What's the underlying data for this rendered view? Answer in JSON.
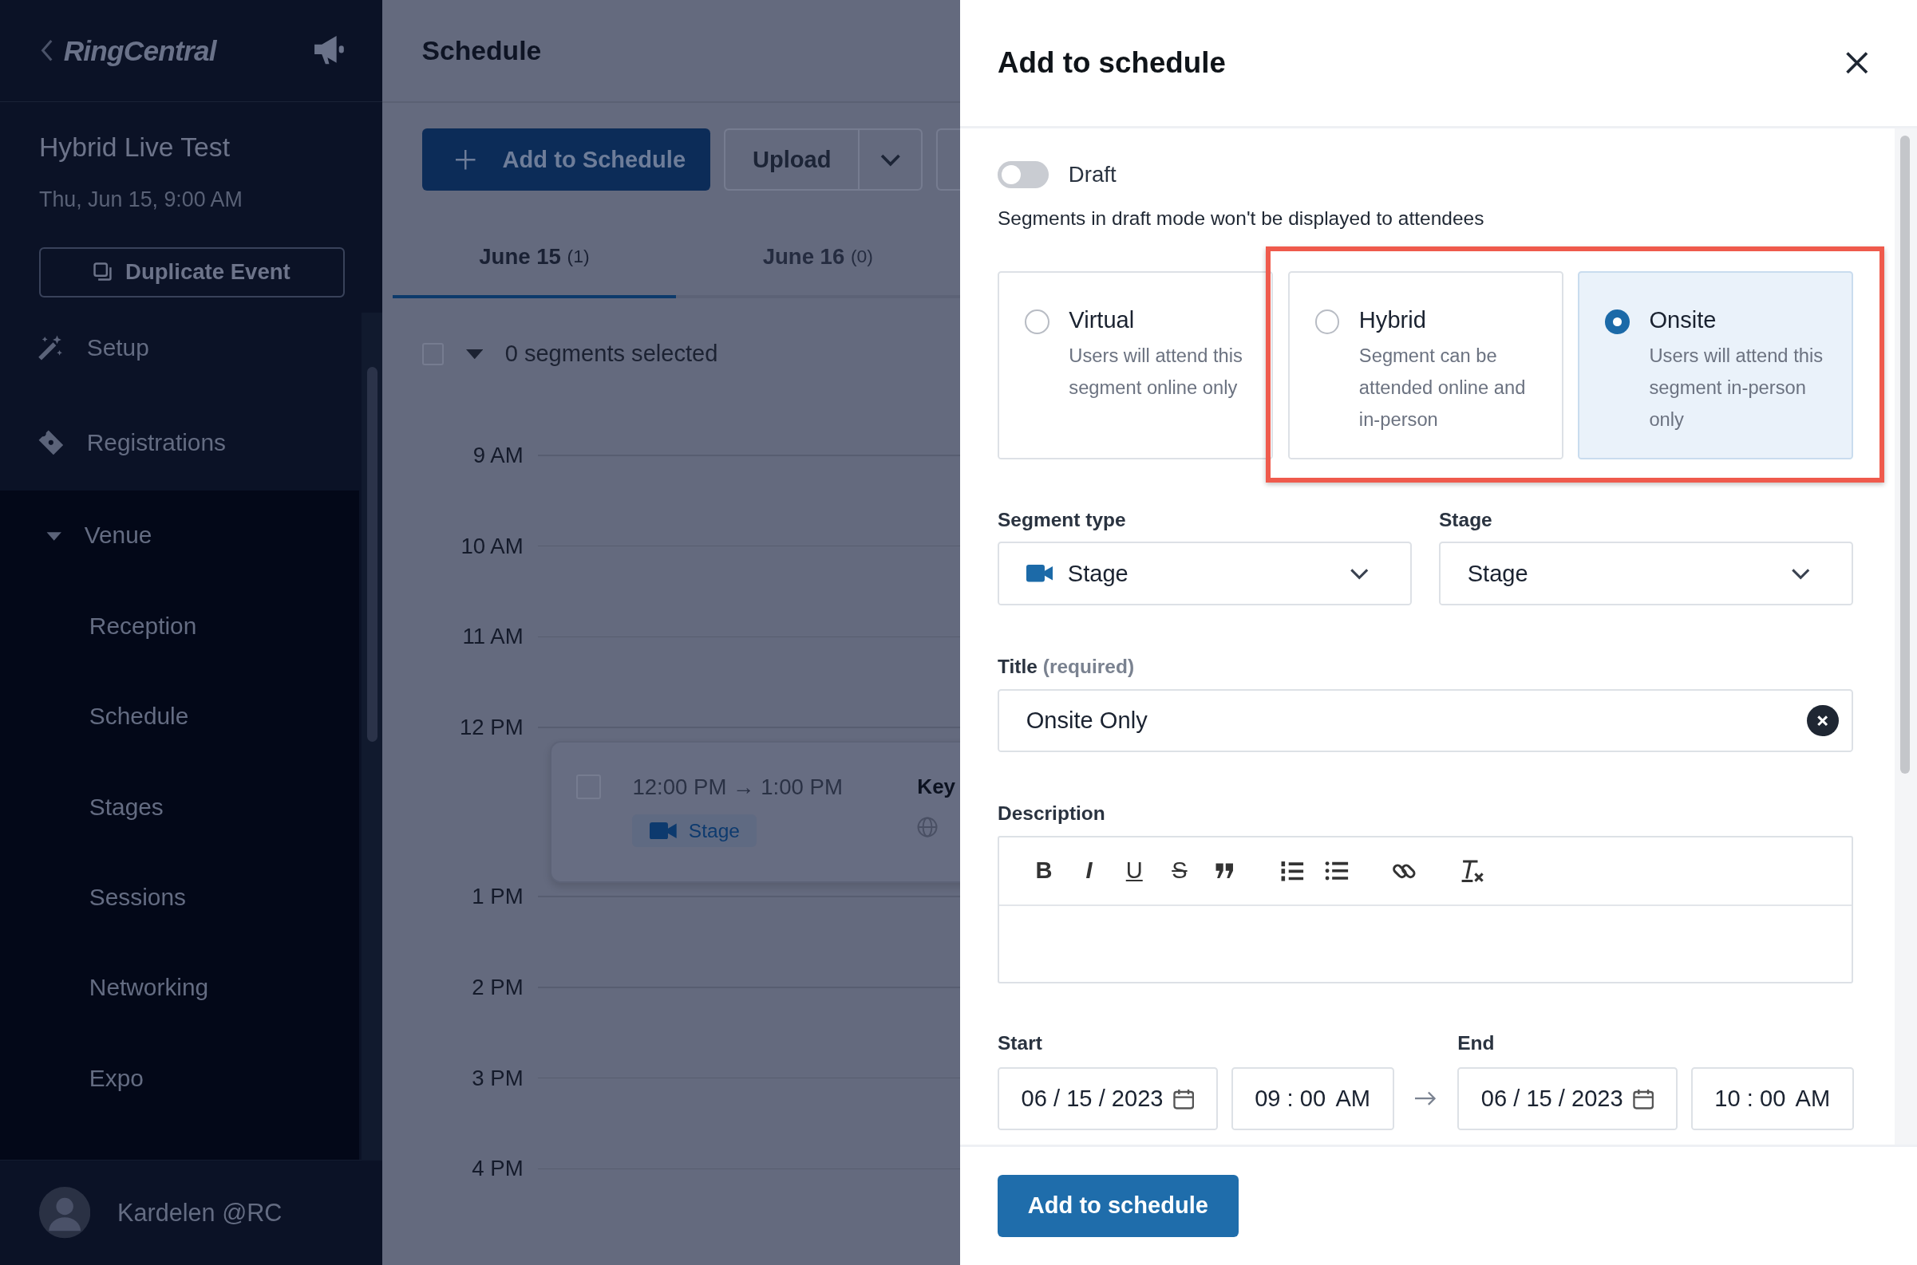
{
  "sidebar": {
    "logo": "RingCentral",
    "event_title": "Hybrid Live Test",
    "event_date": "Thu, Jun 15, 9:00 AM",
    "duplicate_button": "Duplicate Event",
    "nav_items": [
      {
        "label": "Setup",
        "kind": "wand"
      },
      {
        "label": "Registrations",
        "kind": "ticket"
      },
      {
        "label": "Venue",
        "kind": "group",
        "expanded": true,
        "children": [
          {
            "label": "Reception"
          },
          {
            "label": "Schedule"
          },
          {
            "label": "Stages"
          },
          {
            "label": "Sessions"
          },
          {
            "label": "Networking"
          },
          {
            "label": "Expo"
          }
        ]
      }
    ],
    "user": {
      "name": "Kardelen @RC"
    }
  },
  "main": {
    "title": "Schedule",
    "add_button": "Add to Schedule",
    "upload_button": "Upload",
    "tabs": [
      {
        "label": "June 15",
        "count": "(1)",
        "selected": true
      },
      {
        "label": "June 16",
        "count": "(0)",
        "selected": false
      }
    ],
    "select_all_checked": false,
    "selection_text": "0 segments selected",
    "hours": [
      {
        "label": "9 AM"
      },
      {
        "label": "10 AM"
      },
      {
        "label": "11 AM"
      },
      {
        "label": "12 PM",
        "events": [
          {
            "start": "12:00 PM",
            "arrow": "→",
            "end": "1:00 PM",
            "title": "Key",
            "tag": "Stage",
            "checked": false
          }
        ]
      },
      {
        "label": "1 PM"
      },
      {
        "label": "2 PM"
      },
      {
        "label": "3 PM"
      },
      {
        "label": "4 PM"
      }
    ]
  },
  "panel": {
    "title": "Add to schedule",
    "draft": {
      "label": "Draft",
      "on": false
    },
    "draft_hint": "Segments in draft mode won't be displayed to attendees",
    "attendance_options": [
      {
        "label": "Virtual",
        "description": "Users will attend this segment online only",
        "selected": false
      },
      {
        "label": "Hybrid",
        "description": "Segment can be attended online and in-person",
        "selected": false
      },
      {
        "label": "Onsite",
        "description": "Users will attend this segment in-person only",
        "selected": true
      }
    ],
    "segment_type": {
      "label": "Segment type",
      "value": "Stage"
    },
    "stage": {
      "label": "Stage",
      "value": "Stage"
    },
    "title_field": {
      "label": "Title",
      "note": "(required)",
      "value": "Onsite Only"
    },
    "description": {
      "label": "Description",
      "tools": [
        {
          "kind": "bold",
          "glyph": "B"
        },
        {
          "kind": "italic",
          "glyph": "I"
        },
        {
          "kind": "underline",
          "glyph": "U"
        },
        {
          "kind": "strike",
          "glyph": "S"
        },
        {
          "kind": "quote"
        },
        {
          "kind": "ordered-list"
        },
        {
          "kind": "bullet-list"
        },
        {
          "kind": "link"
        },
        {
          "kind": "clear-format"
        }
      ]
    },
    "start": {
      "label": "Start",
      "date": "06 / 15 / 2023",
      "time": "09 : 00",
      "period": "AM"
    },
    "end": {
      "label": "End",
      "date": "06 / 15 / 2023",
      "time": "10 : 00",
      "period": "AM"
    },
    "submit": "Add to schedule"
  }
}
